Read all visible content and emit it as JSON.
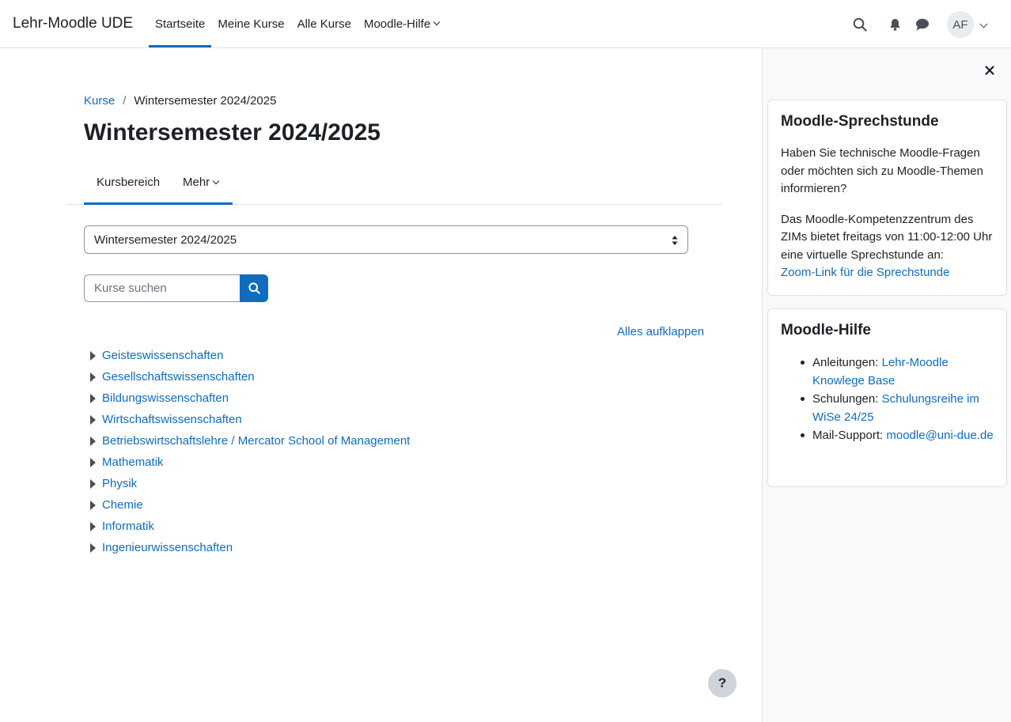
{
  "navbar": {
    "brand": "Lehr-Moodle UDE",
    "items": [
      "Startseite",
      "Meine Kurse",
      "Alle Kurse",
      "Moodle-Hilfe"
    ],
    "user_initials": "AF"
  },
  "breadcrumb": {
    "root": "Kurse",
    "separator": "/",
    "current": "Wintersemester 2024/2025"
  },
  "page": {
    "title": "Wintersemester 2024/2025",
    "secondary_nav": [
      "Kursbereich",
      "Mehr"
    ],
    "category_select_value": "Wintersemester 2024/2025",
    "search_placeholder": "Kurse suchen",
    "expand_all": "Alles aufklappen",
    "help_label": "?"
  },
  "categories": [
    "Geisteswissenschaften",
    "Gesellschaftswissenschaften",
    "Bildungswissenschaften",
    "Wirtschaftswissenschaften",
    "Betriebswirtschaftslehre / Mercator School of Management",
    "Mathematik",
    "Physik",
    "Chemie",
    "Informatik",
    "Ingenieurwissenschaften"
  ],
  "drawer": {
    "block1": {
      "title": "Moodle-Sprechstunde",
      "p1": "Haben Sie technische Moodle-Fragen oder möchten sich zu Moodle-Themen informieren?",
      "p2": "Das Moodle-Kompetenzzentrum des ZIMs bietet freitags von 11:00-12:00 Uhr eine virtuelle Sprechstunde an:",
      "link": "Zoom-Link für die Sprechstunde"
    },
    "block2": {
      "title": "Moodle-Hilfe",
      "items": [
        {
          "label": "Anleitungen: ",
          "link": "Lehr-Moodle Knowlege Base"
        },
        {
          "label": "Schulungen: ",
          "link": "Schulungsreihe im WiSe 24/25"
        },
        {
          "label": "Mail-Support: ",
          "link": "moodle@uni-due.de"
        }
      ]
    }
  },
  "colors": {
    "accent": "#0f6cbf",
    "drawer_bg": "#f8f9fa",
    "text": "#1d2125"
  },
  "icons": [
    "search-icon",
    "bell-icon",
    "chat-icon",
    "chevron-down-icon",
    "close-icon",
    "caret-right-icon",
    "select-arrows-icon",
    "help-icon"
  ]
}
